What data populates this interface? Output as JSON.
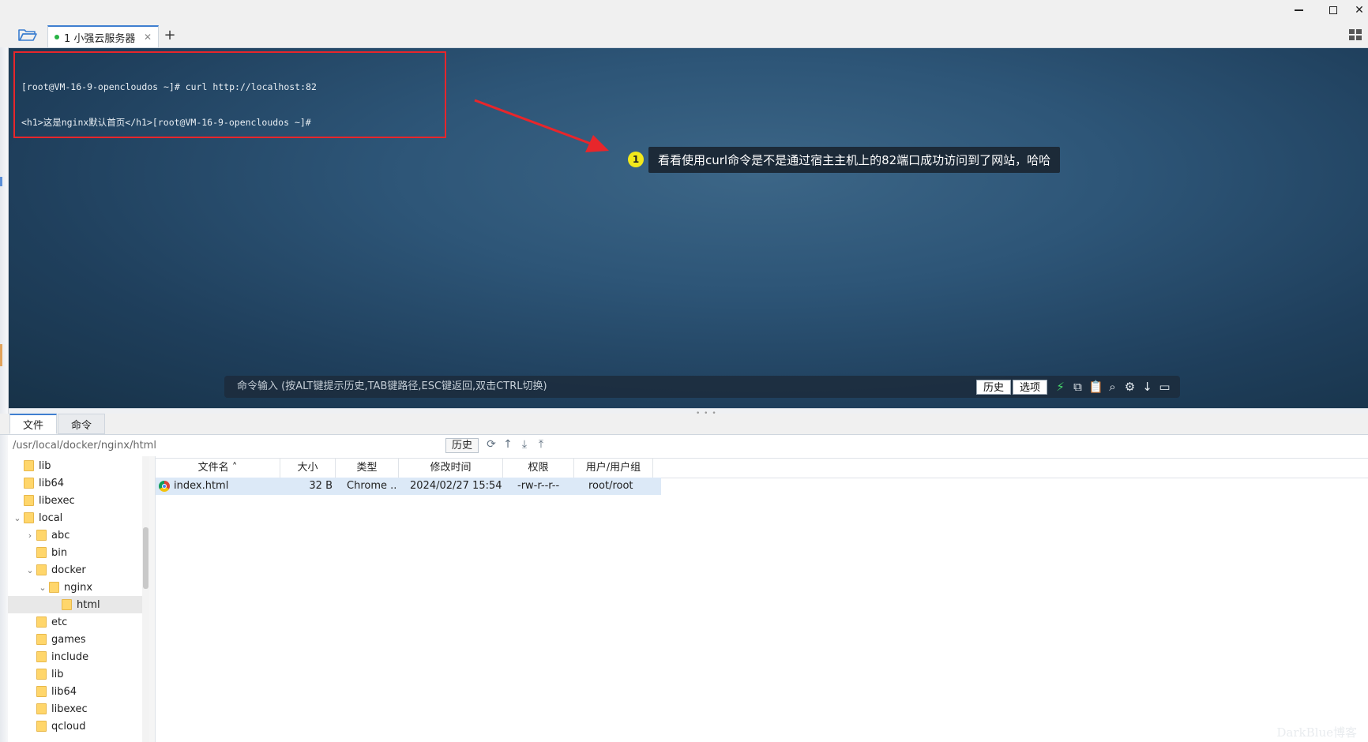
{
  "window": {
    "controls": [
      "minimize",
      "maximize",
      "close"
    ]
  },
  "tabs": {
    "active_tab": {
      "label": "1 小强云服务器",
      "status_color": "#28b345"
    },
    "new_tab_label": "+"
  },
  "terminal": {
    "lines": [
      "[root@VM-16-9-opencloudos ~]# curl http://localhost:82",
      "<h1>这是nginx默认首页</h1>[root@VM-16-9-opencloudos ~]#"
    ],
    "annotation": {
      "number": "1",
      "text": "看看使用curl命令是不是通过宿主主机上的82端口成功访问到了网站，哈哈",
      "box_color": "#e8262b"
    },
    "command_bar": {
      "placeholder": "命令输入 (按ALT键提示历史,TAB键路径,ESC键返回,双击CTRL切换)",
      "history_label": "历史",
      "options_label": "选项",
      "icons": [
        "bolt-icon",
        "copy-icon",
        "paste-icon",
        "search-icon",
        "gear-icon",
        "download-icon",
        "window-icon"
      ]
    }
  },
  "bottom_tabs": [
    {
      "label": "文件",
      "active": true
    },
    {
      "label": "命令",
      "active": false
    }
  ],
  "path_bar": {
    "path": "/usr/local/docker/nginx/html",
    "history_label": "历史",
    "icons": [
      "refresh-icon",
      "up-icon",
      "download-icon",
      "upload-icon"
    ]
  },
  "tree": {
    "items": [
      {
        "label": "lib",
        "depth": 1,
        "expanded": null,
        "selected": false
      },
      {
        "label": "lib64",
        "depth": 1,
        "expanded": null,
        "selected": false
      },
      {
        "label": "libexec",
        "depth": 1,
        "expanded": null,
        "selected": false
      },
      {
        "label": "local",
        "depth": 1,
        "expanded": true,
        "selected": false
      },
      {
        "label": "abc",
        "depth": 2,
        "expanded": false,
        "selected": false
      },
      {
        "label": "bin",
        "depth": 2,
        "expanded": null,
        "selected": false
      },
      {
        "label": "docker",
        "depth": 2,
        "expanded": true,
        "selected": false
      },
      {
        "label": "nginx",
        "depth": 3,
        "expanded": true,
        "selected": false
      },
      {
        "label": "html",
        "depth": 4,
        "expanded": null,
        "selected": true
      },
      {
        "label": "etc",
        "depth": 2,
        "expanded": null,
        "selected": false
      },
      {
        "label": "games",
        "depth": 2,
        "expanded": null,
        "selected": false
      },
      {
        "label": "include",
        "depth": 2,
        "expanded": null,
        "selected": false
      },
      {
        "label": "lib",
        "depth": 2,
        "expanded": null,
        "selected": false
      },
      {
        "label": "lib64",
        "depth": 2,
        "expanded": null,
        "selected": false
      },
      {
        "label": "libexec",
        "depth": 2,
        "expanded": null,
        "selected": false
      },
      {
        "label": "qcloud",
        "depth": 2,
        "expanded": null,
        "selected": false
      }
    ]
  },
  "files": {
    "columns": [
      "文件名",
      "大小",
      "类型",
      "修改时间",
      "权限",
      "用户/用户组"
    ],
    "rows": [
      {
        "name": "index.html",
        "size": "32 B",
        "type": "Chrome ...",
        "modified": "2024/02/27 15:54",
        "permissions": "-rw-r--r--",
        "owner": "root/root",
        "icon": "chrome-icon"
      }
    ]
  },
  "watermark": "DarkBlue博客"
}
